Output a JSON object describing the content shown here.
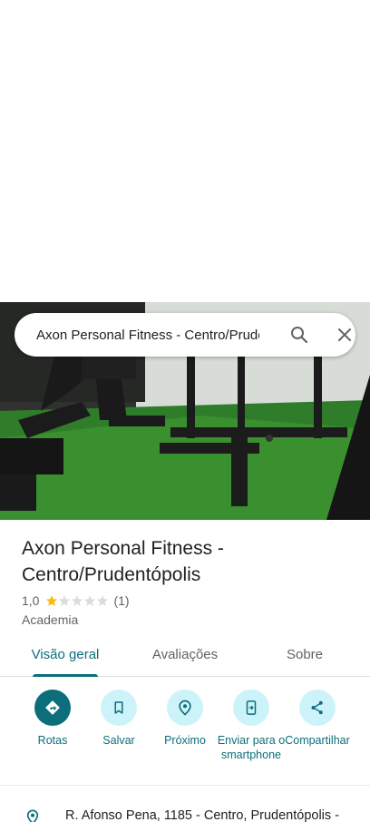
{
  "search": {
    "value": "Axon Personal Fitness - Centro/Prudentópolis"
  },
  "place": {
    "title": "Axon Personal Fitness - Centro/Prudentópolis",
    "rating": "1,0",
    "rating_value": 1,
    "rating_max": 5,
    "review_count": "(1)",
    "category": "Academia"
  },
  "tabs": [
    {
      "label": "Visão geral",
      "active": true
    },
    {
      "label": "Avaliações",
      "active": false
    },
    {
      "label": "Sobre",
      "active": false
    }
  ],
  "actions": [
    {
      "label": "Rotas",
      "icon": "directions-icon"
    },
    {
      "label": "Salvar",
      "icon": "bookmark-icon"
    },
    {
      "label": "Próximo",
      "icon": "nearby-icon"
    },
    {
      "label": "Enviar para o smartphone",
      "icon": "send-to-phone-icon"
    },
    {
      "label": "Compartilhar",
      "icon": "share-icon"
    }
  ],
  "address": "R. Afonso Pena, 1185 - Centro, Prudentópolis -",
  "colors": {
    "accent": "#0b6e7a",
    "accent_light": "#cdf3fa",
    "star": "#fbbc04",
    "text_primary": "#202124",
    "text_secondary": "#5f6368"
  }
}
